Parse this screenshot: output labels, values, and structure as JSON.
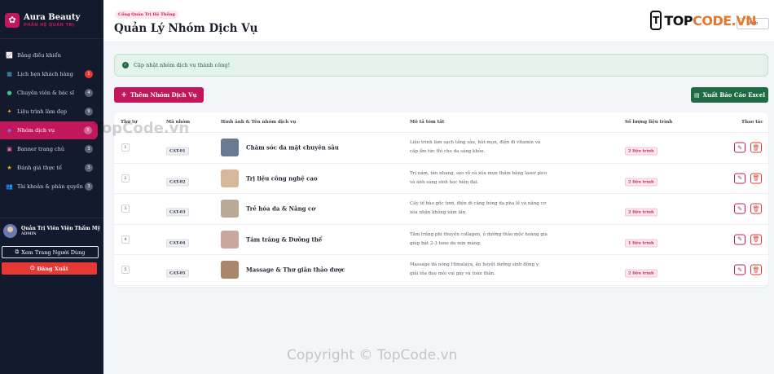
{
  "brand": {
    "title": "Aura Beauty",
    "subtitle": "PHẦN HỆ QUẢN TRỊ",
    "logo_icon": "lotus-icon"
  },
  "sidebar": {
    "items": [
      {
        "label": "Bảng điều khiển",
        "icon": "chart-icon",
        "badge": ""
      },
      {
        "label": "Lịch hẹn khách hàng",
        "icon": "calendar-icon",
        "badge": "1",
        "badge_color": "#e53935"
      },
      {
        "label": "Chuyên viên & bác sĩ",
        "icon": "doctor-icon",
        "badge": "4"
      },
      {
        "label": "Liệu trình làm đẹp",
        "icon": "wand-icon",
        "badge": "9"
      },
      {
        "label": "Nhóm dịch vụ",
        "icon": "layers-icon",
        "badge": "5",
        "active": true
      },
      {
        "label": "Banner trang chủ",
        "icon": "image-icon",
        "badge": "3"
      },
      {
        "label": "Đánh giá thực tế",
        "icon": "star-icon",
        "badge": "3"
      },
      {
        "label": "Tài khoản & phân quyền",
        "icon": "users-icon",
        "badge": "3"
      }
    ]
  },
  "user": {
    "name": "Quản Trị Viên Viện Thẩm Mỹ",
    "role": "ADMIN"
  },
  "buttons": {
    "view_site": "Xem Trang Người Dùng",
    "logout": "Đăng Xuất",
    "add": "Thêm Nhóm Dịch Vụ",
    "export": "Xuất Báo Cáo Excel",
    "web": "Web"
  },
  "header": {
    "breadcrumb": "Cổng Quản Trị Hệ Thống",
    "title": "Quản Lý Nhóm Dịch Vụ"
  },
  "alert": {
    "text": "Cập nhật nhóm dịch vụ thành công!"
  },
  "table": {
    "headers": [
      "Thứ tự",
      "Mã nhóm",
      "Hình ảnh & Tên nhóm dịch vụ",
      "Mô tả tóm tắt",
      "Số lượng liệu trình",
      "Thao tác"
    ],
    "rows": [
      {
        "order": "1",
        "code": "CAT-01",
        "name": "Chăm sóc da mặt chuyên sâu",
        "desc": "Liệu trình làm sạch tầng sâu, hút mụn, điện di vitamin và cấp ẩm tức thì cho da sáng khỏe.",
        "qty": "2 liệu trình",
        "thumb": "#6b7a90"
      },
      {
        "order": "2",
        "code": "CAT-02",
        "name": "Trị liệu công nghệ cao",
        "desc": "Trị nám, tàn nhang, sẹo rỗ và xóa mụn thâm bằng laser pico và ánh sáng sinh học hiện đại.",
        "qty": "2 liệu trình",
        "thumb": "#d7b79a"
      },
      {
        "order": "3",
        "code": "CAT-03",
        "name": "Trẻ hóa da & Nâng cơ",
        "desc": "Cấy tế bào gốc tươi, điện di căng bóng da pha lê và nâng cơ xóa nhăn không xâm lấn.",
        "qty": "2 liệu trình",
        "thumb": "#b9aa98"
      },
      {
        "order": "4",
        "code": "CAT-04",
        "name": "Tắm trắng & Dưỡng thể",
        "desc": "Tắm trắng phi thuyền collagen, ủ dưỡng thảo mộc hoàng gia giúp bật 2-3 tone da mịn màng.",
        "qty": "1 liệu trình",
        "thumb": "#c9a7a0"
      },
      {
        "order": "5",
        "code": "CAT-05",
        "name": "Massage & Thư giãn thảo dược",
        "desc": "Massage đá nóng Himalaya, ấn huyệt dưỡng sinh đông y giải tỏa đau mỏi vai gáy và toàn thân.",
        "qty": "2 liệu trình",
        "thumb": "#a8876a"
      }
    ]
  },
  "watermark": {
    "logo_text_a": "TOP",
    "logo_text_b": "CODE.VN",
    "mark": "T",
    "small": "TopCode.vn",
    "copyright": "Copyright © TopCode.vn"
  }
}
